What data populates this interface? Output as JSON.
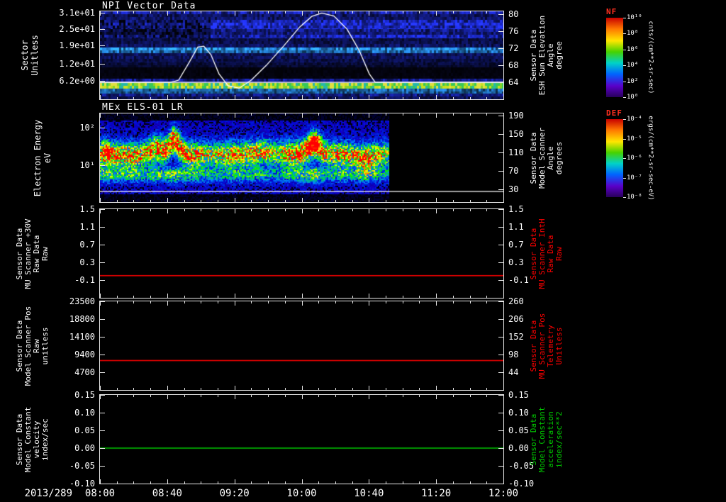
{
  "x_axis": {
    "date_label": "2013/289",
    "tick_labels": [
      "08:00",
      "08:40",
      "09:20",
      "10:00",
      "10:40",
      "11:20",
      "12:00"
    ],
    "start_hour": 8.0,
    "end_hour": 12.0
  },
  "colors": {
    "background": "#000000",
    "foreground": "#ffffff",
    "red_series": "#ff0000",
    "green_series": "#00c800",
    "colorbar_title": "#ff3020",
    "colorbar_palette": [
      "#c80000",
      "#ff7800",
      "#ffe600",
      "#46d200",
      "#00d2c8",
      "#0064ff",
      "#5a00c8",
      "#28005a"
    ]
  },
  "chart_data": [
    {
      "type": "heatmap",
      "title": "NPI Vector Data",
      "left_axis": {
        "label_lines": [
          "Sector",
          "Unitless"
        ],
        "range": [
          31.5,
          -0.5
        ],
        "ticks": [
          {
            "label": "3.1e+01",
            "v": 31
          },
          {
            "label": "2.5e+01",
            "v": 25
          },
          {
            "label": "1.9e+01",
            "v": 19
          },
          {
            "label": "1.2e+01",
            "v": 12.4
          },
          {
            "label": "6.2e+00",
            "v": 6.2
          }
        ]
      },
      "right_axis": {
        "label_lines": [
          "Sensor Data",
          "ESH Sun Elevation",
          "Angle",
          "degree"
        ],
        "range": [
          80.7,
          60.0
        ],
        "ticks": [
          {
            "label": "80",
            "v": 80
          },
          {
            "label": "76",
            "v": 76
          },
          {
            "label": "72",
            "v": 72
          },
          {
            "label": "68",
            "v": 68
          },
          {
            "label": "64",
            "v": 64
          }
        ]
      },
      "colorbar": {
        "title": "NF",
        "units": "cnts/(cm**2-sr-sec)",
        "tick_labels": [
          "10¹⁰",
          "10⁸",
          "10⁶",
          "10⁴",
          "10²",
          "10⁰"
        ]
      },
      "bands": [
        {
          "y0": 0.0,
          "y1": 0.097,
          "kind": "blue",
          "level": 0.55
        },
        {
          "y0": 0.097,
          "y1": 0.2,
          "kind": "blue",
          "level": 0.72
        },
        {
          "y0": 0.2,
          "y1": 0.306,
          "kind": "blue",
          "level": 0.55
        },
        {
          "y0": 0.306,
          "y1": 0.41,
          "kind": "blue",
          "level": 0.35
        },
        {
          "y0": 0.41,
          "y1": 0.476,
          "kind": "cyan",
          "level": 0.8
        },
        {
          "y0": 0.476,
          "y1": 0.58,
          "kind": "blue",
          "level": 0.45
        },
        {
          "y0": 0.58,
          "y1": 0.637,
          "kind": "blue",
          "level": 0.25
        },
        {
          "y0": 0.637,
          "y1": 0.766,
          "kind": "dark",
          "level": 0.1
        },
        {
          "y0": 0.766,
          "y1": 0.815,
          "kind": "blue",
          "level": 0.6
        },
        {
          "y0": 0.815,
          "y1": 0.879,
          "kind": "hot",
          "level": 0.95
        },
        {
          "y0": 0.879,
          "y1": 0.935,
          "kind": "cyan",
          "level": 0.75
        },
        {
          "y0": 0.935,
          "y1": 1.0,
          "kind": "blue",
          "level": 0.5
        }
      ],
      "overlay_series": [
        {
          "name": "sun-elevation-baseline",
          "color": "#ffffff",
          "axis": "right",
          "points": [
            [
              8.0,
              64
            ],
            [
              12.0,
              64
            ]
          ]
        },
        {
          "name": "sun-elevation-angle",
          "color": "#ffffff",
          "axis": "right",
          "points": [
            [
              8.0,
              64
            ],
            [
              8.7,
              64
            ],
            [
              8.78,
              64.5
            ],
            [
              8.88,
              68.5
            ],
            [
              8.97,
              72.3
            ],
            [
              9.03,
              72.5
            ],
            [
              9.1,
              70.5
            ],
            [
              9.18,
              66
            ],
            [
              9.27,
              63.2
            ],
            [
              9.38,
              62.6
            ],
            [
              9.5,
              64.5
            ],
            [
              9.65,
              68
            ],
            [
              9.82,
              72.5
            ],
            [
              9.98,
              77
            ],
            [
              10.1,
              79.5
            ],
            [
              10.2,
              80.3
            ],
            [
              10.32,
              79.6
            ],
            [
              10.45,
              76.5
            ],
            [
              10.57,
              71.5
            ],
            [
              10.67,
              66
            ],
            [
              10.73,
              64
            ],
            [
              12.0,
              64
            ]
          ]
        }
      ]
    },
    {
      "type": "heatmap",
      "title": "MEx ELS-01 LR",
      "left_axis": {
        "label_lines": [
          "Electron Energy",
          "eV"
        ],
        "log": true,
        "range": [
          2.38,
          0.02
        ],
        "ticks": [
          {
            "label": "10²",
            "v": 2
          },
          {
            "label": "10¹",
            "v": 1
          }
        ]
      },
      "right_axis": {
        "label_lines": [
          "Sensor Data",
          "Model Scanner",
          "Angle",
          "degrees"
        ],
        "range": [
          194,
          2
        ],
        "ticks": [
          {
            "label": "190",
            "v": 190
          },
          {
            "label": "150",
            "v": 150
          },
          {
            "label": "110",
            "v": 110
          },
          {
            "label": "70",
            "v": 70
          },
          {
            "label": "30",
            "v": 30
          }
        ]
      },
      "colorbar": {
        "title": "DEF",
        "units": "ergs/(cm**2-sr-sec-eV)",
        "tick_labels": [
          "10⁻⁴",
          "10⁻⁵",
          "10⁻⁶",
          "10⁻⁷",
          "10⁻⁸"
        ]
      },
      "data_end_hour": 10.87,
      "blobs": [
        {
          "t": 8.05,
          "yc": 0.44,
          "a": 0.9,
          "w": 0.05
        },
        {
          "t": 8.3,
          "yc": 0.47,
          "a": 0.7,
          "w": 0.09
        },
        {
          "t": 8.55,
          "yc": 0.4,
          "a": 0.92,
          "w": 0.07
        },
        {
          "t": 8.73,
          "yc": 0.3,
          "a": 0.88,
          "w": 0.05
        },
        {
          "t": 9.0,
          "yc": 0.46,
          "a": 0.72,
          "w": 0.13
        },
        {
          "t": 9.3,
          "yc": 0.46,
          "a": 0.68,
          "w": 0.1
        },
        {
          "t": 9.6,
          "yc": 0.43,
          "a": 0.78,
          "w": 0.09
        },
        {
          "t": 9.9,
          "yc": 0.45,
          "a": 0.8,
          "w": 0.1
        },
        {
          "t": 10.12,
          "yc": 0.34,
          "a": 1.0,
          "w": 0.06
        },
        {
          "t": 10.38,
          "yc": 0.46,
          "a": 0.78,
          "w": 0.08
        },
        {
          "t": 10.62,
          "yc": 0.5,
          "a": 0.7,
          "w": 0.07
        }
      ],
      "overlay_series": [
        {
          "name": "model-scanner-angle",
          "color": "#ffffff",
          "axis": "right",
          "points": [
            [
              8.0,
              25
            ],
            [
              12.0,
              25
            ]
          ]
        }
      ]
    },
    {
      "type": "line",
      "title": "",
      "left_axis": {
        "label_lines": [
          "Sensor Data",
          "MU Scanner +30V",
          "Raw Data",
          "Raw"
        ],
        "range": [
          1.5,
          -0.5
        ],
        "ticks": [
          {
            "label": "1.5",
            "v": 1.5
          },
          {
            "label": "1.1",
            "v": 1.1
          },
          {
            "label": "0.7",
            "v": 0.7
          },
          {
            "label": "0.3",
            "v": 0.3
          },
          {
            "label": "-0.1",
            "v": -0.1
          }
        ]
      },
      "right_axis": {
        "label_lines": [
          "Sensor Data",
          "MU Scanner IntH",
          "Raw Data",
          "Raw"
        ],
        "label_color": "#ff0000",
        "range": [
          1.5,
          -0.5
        ],
        "ticks": [
          {
            "label": "1.5",
            "v": 1.5
          },
          {
            "label": "1.1",
            "v": 1.1
          },
          {
            "label": "0.7",
            "v": 0.7
          },
          {
            "label": "0.3",
            "v": 0.3
          },
          {
            "label": "-0.1",
            "v": -0.1
          }
        ]
      },
      "series": [
        {
          "name": "mu-scanner-30v-raw",
          "color": "#ff0000",
          "axis": "left",
          "points": [
            [
              8.0,
              0.0
            ],
            [
              12.0,
              0.0
            ]
          ]
        }
      ]
    },
    {
      "type": "line",
      "title": "",
      "left_axis": {
        "label_lines": [
          "Sensor Data",
          "Model Scanner Pos",
          "Raw",
          "unitless"
        ],
        "range": [
          23500,
          0
        ],
        "ticks": [
          {
            "label": "23500",
            "v": 23500
          },
          {
            "label": "18800",
            "v": 18800
          },
          {
            "label": "14100",
            "v": 14100
          },
          {
            "label": "9400",
            "v": 9400
          },
          {
            "label": "4700",
            "v": 4700
          }
        ]
      },
      "right_axis": {
        "label_lines": [
          "Sensor Data",
          "MU Scanner Pos",
          "Telemetry",
          "Unitless"
        ],
        "label_color": "#ff0000",
        "range": [
          260,
          -10
        ],
        "ticks": [
          {
            "label": "260",
            "v": 260
          },
          {
            "label": "206",
            "v": 206
          },
          {
            "label": "152",
            "v": 152
          },
          {
            "label": "98",
            "v": 98
          },
          {
            "label": "44",
            "v": 44
          }
        ]
      },
      "series": [
        {
          "name": "model-scanner-pos-raw",
          "color": "#ff0000",
          "axis": "left",
          "points": [
            [
              8.0,
              7800
            ],
            [
              12.0,
              7800
            ]
          ]
        }
      ]
    },
    {
      "type": "line",
      "title": "",
      "left_axis": {
        "label_lines": [
          "Sensor Data",
          "Model Constant",
          "velocity",
          "index/sec"
        ],
        "range": [
          0.15,
          -0.1
        ],
        "ticks": [
          {
            "label": "0.15",
            "v": 0.15
          },
          {
            "label": "0.10",
            "v": 0.1
          },
          {
            "label": "0.05",
            "v": 0.05
          },
          {
            "label": "0.00",
            "v": 0.0
          },
          {
            "label": "-0.05",
            "v": -0.05
          },
          {
            "label": "-0.10",
            "v": -0.1
          }
        ]
      },
      "right_axis": {
        "label_lines": [
          "Sensor Data",
          "Model Constant",
          "acceleration",
          "index/sec**2"
        ],
        "label_color": "#00c800",
        "range": [
          0.15,
          -0.1
        ],
        "ticks": [
          {
            "label": "0.15",
            "v": 0.15
          },
          {
            "label": "0.10",
            "v": 0.1
          },
          {
            "label": "0.05",
            "v": 0.05
          },
          {
            "label": "0.00",
            "v": 0.0
          },
          {
            "label": "-0.05",
            "v": -0.05
          },
          {
            "label": "-0.10",
            "v": -0.1
          }
        ]
      },
      "series": [
        {
          "name": "model-constant-velocity",
          "color": "#00c800",
          "axis": "left",
          "points": [
            [
              8.0,
              0.0
            ],
            [
              12.0,
              0.0
            ]
          ]
        }
      ]
    }
  ]
}
